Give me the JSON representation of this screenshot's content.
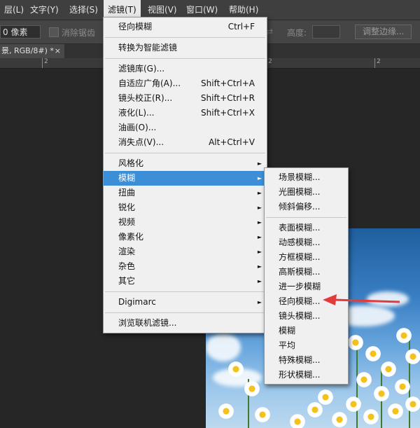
{
  "menubar": {
    "items": [
      {
        "label": "层(L)"
      },
      {
        "label": "文字(Y)"
      },
      {
        "label": "选择(S)"
      },
      {
        "label": "滤镜(T)"
      },
      {
        "label": "视图(V)"
      },
      {
        "label": "窗口(W)"
      },
      {
        "label": "帮助(H)"
      }
    ]
  },
  "options": {
    "feather_value": "0 像素",
    "antialias_label": "消除锯齿",
    "height_label": "高度:",
    "height_value": "",
    "refine_edge_label": "调整边缘..."
  },
  "document": {
    "tab_title": "景, RGB/8#) *",
    "close_glyph": "×"
  },
  "ruler": {
    "labels": [
      "2",
      "2",
      "2"
    ]
  },
  "filter_menu": {
    "items": [
      {
        "label": "径向模糊",
        "shortcut": "Ctrl+F"
      },
      {
        "label": "转换为智能滤镜",
        "shortcut": ""
      },
      {
        "label": "滤镜库(G)...",
        "shortcut": ""
      },
      {
        "label": "自适应广角(A)...",
        "shortcut": "Shift+Ctrl+A"
      },
      {
        "label": "镜头校正(R)...",
        "shortcut": "Shift+Ctrl+R"
      },
      {
        "label": "液化(L)...",
        "shortcut": "Shift+Ctrl+X"
      },
      {
        "label": "油画(O)...",
        "shortcut": ""
      },
      {
        "label": "消失点(V)...",
        "shortcut": "Alt+Ctrl+V"
      },
      {
        "label": "风格化",
        "shortcut": ""
      },
      {
        "label": "模糊",
        "shortcut": ""
      },
      {
        "label": "扭曲",
        "shortcut": ""
      },
      {
        "label": "锐化",
        "shortcut": ""
      },
      {
        "label": "视频",
        "shortcut": ""
      },
      {
        "label": "像素化",
        "shortcut": ""
      },
      {
        "label": "渲染",
        "shortcut": ""
      },
      {
        "label": "杂色",
        "shortcut": ""
      },
      {
        "label": "其它",
        "shortcut": ""
      },
      {
        "label": "Digimarc",
        "shortcut": ""
      },
      {
        "label": "浏览联机滤镜...",
        "shortcut": ""
      }
    ],
    "submenu_arrow": "►"
  },
  "blur_submenu": {
    "items": [
      {
        "label": "场景模糊..."
      },
      {
        "label": "光圈模糊..."
      },
      {
        "label": "倾斜偏移..."
      },
      {
        "label": "表面模糊..."
      },
      {
        "label": "动感模糊..."
      },
      {
        "label": "方框模糊..."
      },
      {
        "label": "高斯模糊..."
      },
      {
        "label": "进一步模糊"
      },
      {
        "label": "径向模糊..."
      },
      {
        "label": "镜头模糊..."
      },
      {
        "label": "模糊"
      },
      {
        "label": "平均"
      },
      {
        "label": "特殊模糊..."
      },
      {
        "label": "形状模糊..."
      }
    ]
  },
  "colors": {
    "menu_highlight": "#3c8fd6",
    "annotation_arrow": "#e23b3b",
    "menu_background": "#f0f0f0"
  }
}
